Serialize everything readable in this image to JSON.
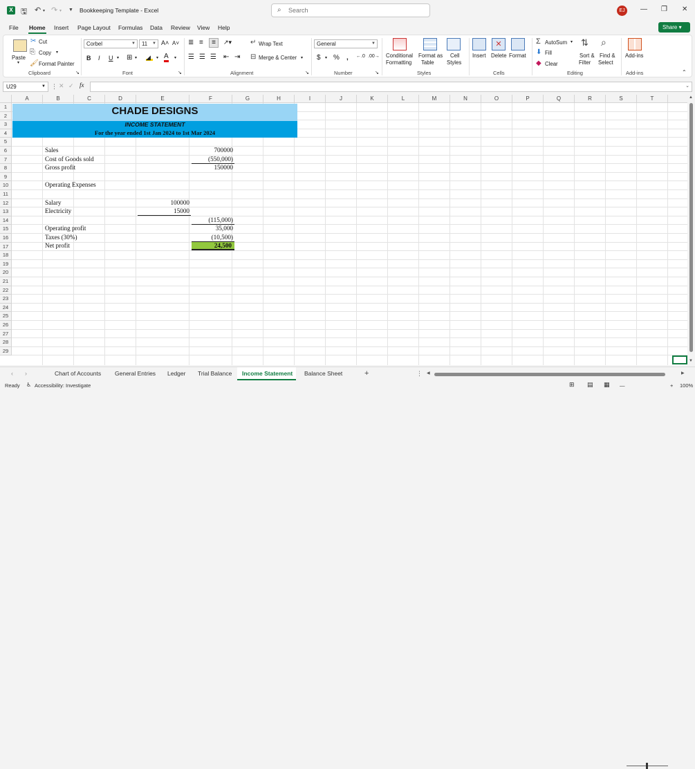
{
  "window": {
    "title": "Bookkeeping Template - Excel",
    "search_placeholder": "Search",
    "avatar_initials": "EJ"
  },
  "menu": [
    "File",
    "Home",
    "Insert",
    "Page Layout",
    "Formulas",
    "Data",
    "Review",
    "View",
    "Help"
  ],
  "share_label": "Share",
  "ribbon": {
    "clipboard": {
      "paste": "Paste",
      "cut": "Cut",
      "copy": "Copy",
      "format_painter": "Format Painter",
      "label": "Clipboard"
    },
    "font": {
      "name": "Corbel",
      "size": "11",
      "label": "Font"
    },
    "alignment": {
      "wrap": "Wrap Text",
      "merge": "Merge & Center",
      "label": "Alignment"
    },
    "number": {
      "format": "General",
      "label": "Number"
    },
    "styles": {
      "cond": "Conditional",
      "cond2": "Formatting",
      "fmt_table": "Format as",
      "fmt_table2": "Table",
      "cell_styles": "Cell",
      "cell_styles2": "Styles",
      "label": "Styles"
    },
    "cells": {
      "insert": "Insert",
      "delete": "Delete",
      "format": "Format",
      "label": "Cells"
    },
    "editing": {
      "autosum": "AutoSum",
      "fill": "Fill",
      "clear": "Clear",
      "sort": "Sort &",
      "sort2": "Filter",
      "find": "Find &",
      "find2": "Select",
      "label": "Editing"
    },
    "addins": {
      "addins": "Add-ins",
      "label": "Add-ins"
    }
  },
  "formula_bar": {
    "name_box": "U29",
    "fx": "fx"
  },
  "columns": [
    "A",
    "B",
    "C",
    "D",
    "E",
    "F",
    "G",
    "H",
    "I",
    "J",
    "K",
    "L",
    "M",
    "N",
    "O",
    "P",
    "Q",
    "R",
    "S",
    "T"
  ],
  "rows": [
    "1",
    "2",
    "3",
    "4",
    "5",
    "6",
    "7",
    "8",
    "9",
    "10",
    "11",
    "12",
    "13",
    "14",
    "15",
    "16",
    "17",
    "18",
    "19",
    "20",
    "21",
    "22",
    "23",
    "24",
    "25",
    "26",
    "27",
    "28",
    "29"
  ],
  "sheet": {
    "company": "CHADE DESIGNS",
    "statement": "INCOME STATEMENT",
    "period": "For the year ended 1st Jan 2024 to 1st Mar 2024",
    "lines": [
      {
        "label": "Sales",
        "value": "700000"
      },
      {
        "label": "Cost of Goods sold",
        "value": "(550,000)"
      },
      {
        "label": "Gross profit",
        "value": "150000"
      },
      {
        "label": "Operating Expenses"
      },
      {
        "label": "Salary",
        "value_e": "100000"
      },
      {
        "label": "Electricity",
        "value_e": "15000"
      },
      {
        "value": "(115,000)"
      },
      {
        "label": "Operating profit",
        "value": "35,000"
      },
      {
        "label": "Taxes (30%)",
        "value": "(10,500)"
      },
      {
        "label": "Net profit",
        "value": "24,500"
      }
    ],
    "colors": {
      "header_light": "#99d5f5",
      "header_dark": "#009fe0",
      "net_profit_fill": "#92c83e"
    }
  },
  "sheet_tabs": [
    "Chart of Accounts",
    "General Entries",
    "Ledger",
    "Trial Balance",
    "Income Statement",
    "Balance Sheet"
  ],
  "status": {
    "ready": "Ready",
    "accessibility": "Accessibility: Investigate",
    "zoom": "100%"
  }
}
